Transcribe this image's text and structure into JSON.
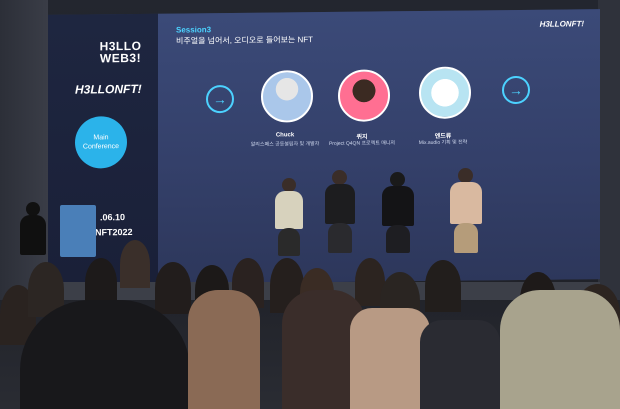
{
  "screen": {
    "left_logo_top": "H3LLO WEB3!",
    "left_logo_nft": "H3LLONFT!",
    "main_conference": "Main Conference",
    "date": ".06.10",
    "tagline": "NFT2022",
    "session": "Session3",
    "subtitle": "비주얼을 넘어서, 오디오로 들어보는 NFT",
    "right_logo": "H3LLONFT!",
    "arrow_left": "→",
    "arrow_right": "→",
    "speakers": [
      {
        "name": "Chuck",
        "role": "알리스페스 공동설립자 및 개발자"
      },
      {
        "name": "퀴지",
        "role": "Project Q4QN 프로젝트 매니저"
      },
      {
        "name": "엔드류",
        "role": "Mix.audio 기획 및 전략"
      }
    ]
  },
  "colors": {
    "accent_cyan": "#4cd2ff",
    "main_conf_circle": "#2bb3ea",
    "screen_main": "#3b4a78"
  }
}
